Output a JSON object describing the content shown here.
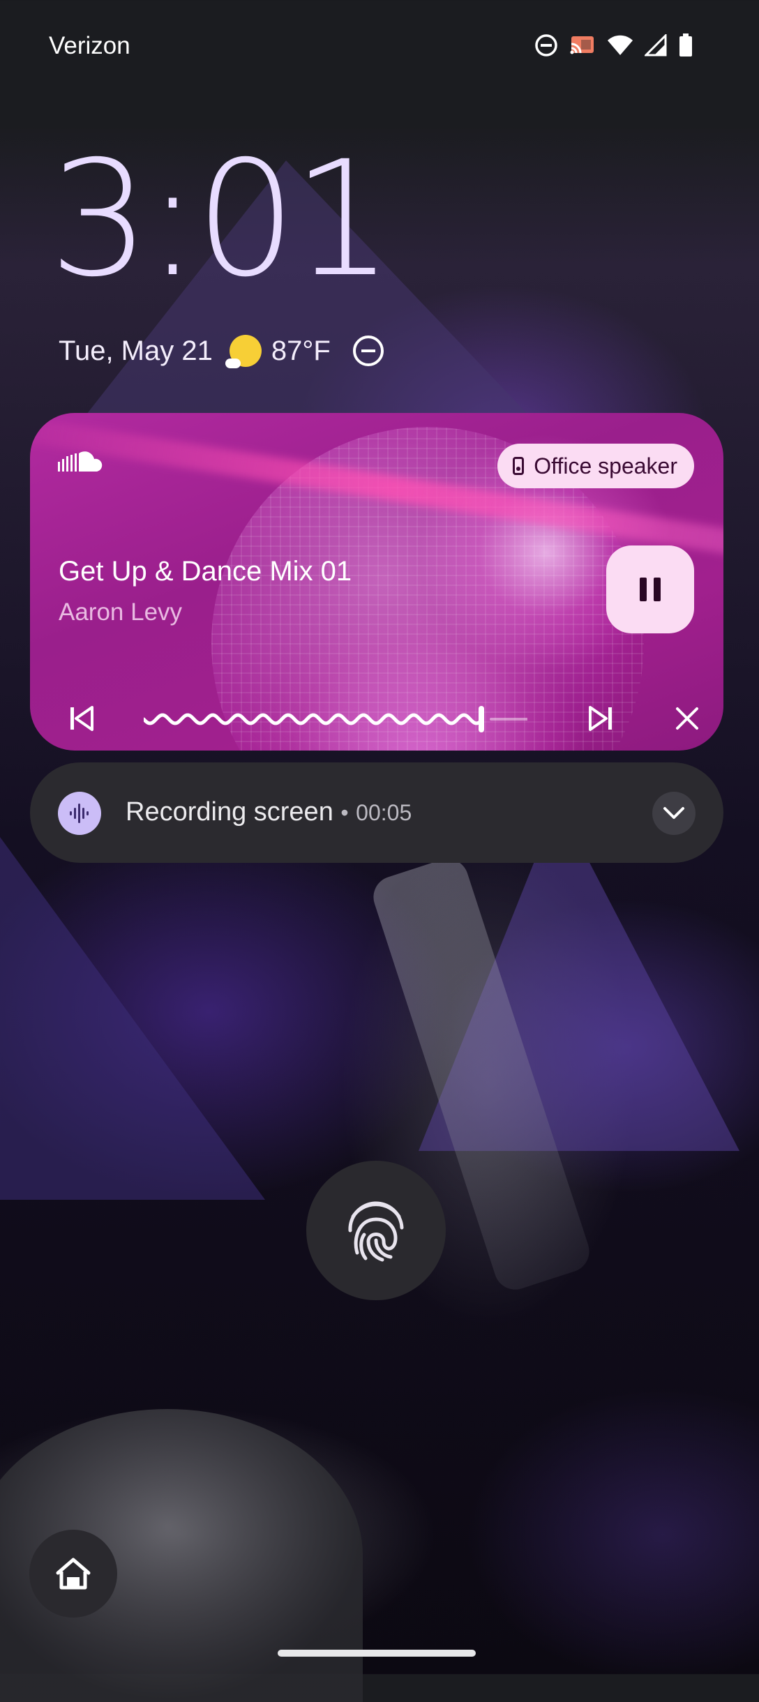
{
  "status_bar": {
    "carrier": "Verizon",
    "icons": [
      "do-not-disturb-icon",
      "cast-icon",
      "wifi-icon",
      "cell-signal-icon",
      "battery-icon"
    ]
  },
  "lockscreen": {
    "time": "3:01",
    "date": "Tue, May 21",
    "weather_icon": "partly-sunny-icon",
    "temperature": "87°F",
    "status_icon": "do-not-disturb-icon"
  },
  "media": {
    "app_icon": "soundcloud-icon",
    "output_device": "Office speaker",
    "title": "Get Up & Dance Mix 01",
    "artist": "Aaron Levy",
    "play_state_icon": "pause-icon",
    "progress_fraction": 0.88,
    "controls": [
      "skip-previous-icon",
      "skip-next-icon",
      "close-icon"
    ],
    "accent_color": "#b22aa0",
    "chip_color": "#fbdcf3"
  },
  "notification": {
    "icon": "sound-wave-icon",
    "title": "Recording screen",
    "separator": "•",
    "elapsed": "00:05",
    "expand_icon": "chevron-down-icon"
  },
  "fingerprint": {
    "icon": "fingerprint-icon"
  },
  "shortcut": {
    "icon": "home-icon"
  }
}
